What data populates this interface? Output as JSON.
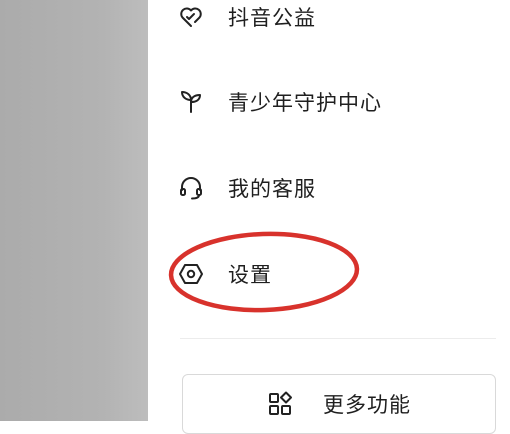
{
  "menu": {
    "items": [
      {
        "label": "抖音公益",
        "icon": "heart-charity-icon"
      },
      {
        "label": "青少年守护中心",
        "icon": "sprout-icon"
      },
      {
        "label": "我的客服",
        "icon": "headset-icon"
      },
      {
        "label": "设置",
        "icon": "hexagon-settings-icon"
      }
    ]
  },
  "more": {
    "label": "更多功能",
    "icon": "grid-apps-icon"
  },
  "colors": {
    "highlight_circle": "#d8322c",
    "overlay": "#b0b0b0",
    "text": "#1f1f1f"
  }
}
